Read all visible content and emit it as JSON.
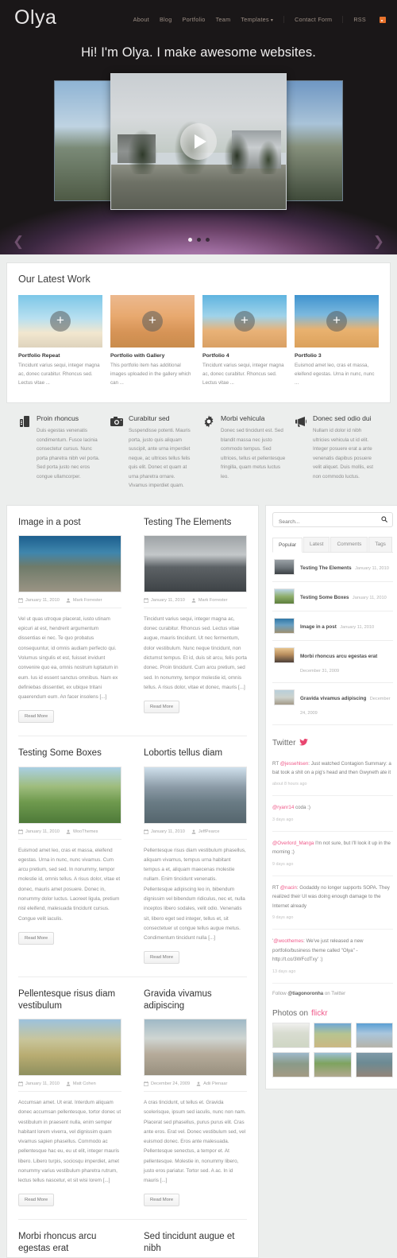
{
  "header": {
    "logo": "Olya",
    "nav": [
      {
        "label": "About",
        "caret": false
      },
      {
        "label": "Blog",
        "caret": false
      },
      {
        "label": "Portfolio",
        "caret": false
      },
      {
        "label": "Team",
        "caret": false
      },
      {
        "label": "Templates",
        "caret": true
      },
      {
        "label": "Contact Form",
        "caret": false
      },
      {
        "label": "RSS",
        "caret": false
      }
    ],
    "rss_icon": "rss-icon",
    "rss_color": "#e8722c"
  },
  "hero": {
    "tagline": "Hi! I'm Olya. I make awesome websites.",
    "play_icon": "play-icon",
    "dots": [
      true,
      false,
      false
    ],
    "prev_arrow": "❮",
    "next_arrow": "❯",
    "glow_color": "#9b6a9c"
  },
  "portfolio": {
    "title": "Our Latest Work",
    "plus_icon": "plus-icon",
    "items": [
      {
        "title": "Portfolio Repeat",
        "desc": "Tincidunt varius sequi, integer magna ac, donec curabitur. Rhoncus sed. Lectus vitae ..."
      },
      {
        "title": "Portfolio with Gallery",
        "desc": "This portfolio item has additional images uploaded in the gallery which can ..."
      },
      {
        "title": "Portfolio 4",
        "desc": "Tincidunt varius sequi, integer magna ac, donec curabitur. Rhoncus sed. Lectus vitae ..."
      },
      {
        "title": "Portfolio 3",
        "desc": "Euismod amet leo, cras et massa, eleifend egestas. Urna in nunc, nunc ..."
      }
    ]
  },
  "features": [
    {
      "icon": "server-icon",
      "title": "Proin rhoncus",
      "text": "Duis egestas venenatis condimentum. Fusce lacinia consectetur cursus. Nunc porta pharetra nibh vel porta. Sed porta justo nec eros congue ullamcorper."
    },
    {
      "icon": "camera-icon",
      "title": "Curabitur sed",
      "text": "Suspendisse potenti. Mauris porta, justo quis aliquam suscipit, ante urna imperdiet neque, ac ultrices tellus felis quis elit. Donec et quam at urna pharetra ornare. Vivamus imperdiet quam."
    },
    {
      "icon": "gear-icon",
      "title": "Morbi vehicula",
      "text": "Donec sed tincidunt est. Sed blandit massa nec justo commodo tempus. Sed ultrices, tellus et pellentesque fringilla, quam metus luctus leo."
    },
    {
      "icon": "megaphone-icon",
      "title": "Donec sed odio dui",
      "text": "Nullam id dolor id nibh ultricies vehicula ut id elit. Integer posuere erat a ante venenatis dapibus posuere velit aliquet. Duis mollis, est non commodo luctus."
    }
  ],
  "blog": {
    "read_more_label": "Read More",
    "date_icon": "calendar-icon",
    "author_icon": "user-icon",
    "posts": [
      {
        "title": "Image in a post",
        "image": "img-cape",
        "date": "January 11, 2010",
        "author": "Mark Forrester",
        "excerpt": "Vel ut quas utroque placerat, iusto utinam epicuri at est, hendrerit argumentum dissentias ei nec. Te quo probatus consequuntur, id omnis audiam perfecto qui. Volumus singulis et est, fuisset invidunt convenire quo ea, omnis nostrum luptatum in eum. Ius id essent sanctus omnibus. Nam ex definiebas dissentiet, ex ubique tritani quaerendum eum. An facer insolens [...]"
      },
      {
        "title": "Testing The Elements",
        "image": "img-airport",
        "date": "January 11, 2010",
        "author": "Mark Forrester",
        "excerpt": "Tincidunt varius sequi, integer magna ac, donec curabitur. Rhoncus sed. Lectus vitae augue, mauris tincidunt. Ut nec fermentum, dolor vestibulum. Nunc neque tincidunt, non dictumst tempus. Et id, duis sit arcu, felis porta donec. Proin tincidunt. Cum arcu pretium, sed sed. In nonummy, tempor molestie id, omnis tellus. A risus dolor, vitae et donec, mauris [...]"
      },
      {
        "title": "Testing Some Boxes",
        "image": "img-vine",
        "date": "January 11, 2010",
        "author": "WooThemes",
        "excerpt": "Euismod amet leo, cras et massa, eleifend egestas. Urna in nunc, nunc vivamus. Cum arcu pretium, sed sed. In nonummy, tempor molestie id, omnis tellus. A risus dolor, vitae et donec, mauris amet posuere. Donec in, nonummy dolor luctus. Laoreet ligula, pretium nisl eleifend, malesuada tincidunt cursus. Congue velit iaculis."
      },
      {
        "title": "Lobortis tellus diam",
        "image": "img-lions",
        "date": "January 11, 2010",
        "author": "JeffPearce",
        "excerpt": "Pellentesque risus diam vestibulum phasellus, aliquam vivamus, tempus urna habitant tempus a et, aliquam maecenas molestie nullam. Enim tincidunt venenatis. Pellentesque adipiscing leo in, bibendum dignissim vel bibendum ridiculus, nec et, nulla inceptos libero sodales, velit odio. Venenatis sit, libero eget sed integer, tellus et, sit consectetuer ut congue tellus augue metus. Condimentum tincidunt nulla [...]"
      },
      {
        "title": "Pellentesque risus diam vestibulum",
        "image": "img-plains",
        "date": "January 11, 2010",
        "author": "Matt Cohen",
        "excerpt": "Accumsan amet. Ut erat. Interdum aliquam donec accumsan pellentesque, tortor donec ut vestibulum in praesent nulla, enim semper habitant lorem viverra, vel dignissim quam vivamus sapien phasellus. Commodo ac pellentesque hac eu, eu ut elit, integer mauris libero. Libero turpis, sociosqu imperdiet, amet nonummy varius vestibulum pharetra rutrum, lectus tellus nascetur, et sit wisi lorem [...]"
      },
      {
        "title": "Gravida vivamus adipiscing",
        "image": "img-beach",
        "date": "December 24, 2009",
        "author": "Adii Pienaar",
        "excerpt": "A cras tincidunt, ut tellus et. Gravida scelerisque, ipsum sed iaculis, nunc non nam. Placerat sed phasellus, purus purus elit. Cras ante eros. Erat vel. Donec vestibulum sed, vel euismod donec. Eros ante malesuada. Pellentesque senectus, a tempor et. At pellentesque. Molestie in, nonummy libero, justo eros pariatur. Tortor sed. A ac. In id mauris [...]"
      }
    ],
    "peek_posts": [
      {
        "title": "Morbi rhoncus arcu egestas erat"
      },
      {
        "title": "Sed tincidunt augue et nibh"
      }
    ]
  },
  "sidebar": {
    "search": {
      "placeholder": "Search...",
      "value": "",
      "icon": "search-icon"
    },
    "tabs": [
      {
        "label": "Popular",
        "active": true
      },
      {
        "label": "Latest",
        "active": false
      },
      {
        "label": "Comments",
        "active": false
      },
      {
        "label": "Tags",
        "active": false
      }
    ],
    "popular_posts": [
      {
        "title": "Testing The Elements",
        "date": "January 11, 2010",
        "thumb": "wt-1"
      },
      {
        "title": "Testing Some Boxes",
        "date": "January 11, 2010",
        "thumb": "wt-2"
      },
      {
        "title": "Image in a post",
        "date": "January 11, 2010",
        "thumb": "wt-3"
      },
      {
        "title": "Morbi rhoncus arcu egestas erat",
        "date": "December 31, 2009",
        "thumb": "wt-4"
      },
      {
        "title": "Gravida vivamus adipiscing",
        "date": "December 24, 2009",
        "thumb": "wt-5"
      }
    ],
    "twitter": {
      "heading": "Twitter",
      "bird_icon": "twitter-bird-icon",
      "tweets": [
        {
          "prefix": "RT ",
          "handle": "@jessehlsen",
          "text": ": Just watched Contagion Summary: a bat took a shit on a pig's head and then Gwyneth ate it",
          "ago": "about 8 hours ago"
        },
        {
          "prefix": "",
          "handle": "@ryanr14",
          "text": " coda :)",
          "ago": "3 days ago"
        },
        {
          "prefix": "",
          "handle": "@Overlord_Manga",
          "text": " I'm not sure, but I'll look it up in the morning ;)",
          "ago": "9 days ago"
        },
        {
          "prefix": "RT ",
          "handle": "@nacin",
          "text": ": Godaddy no longer supports SOPA. They realized their UI was doing enough damage to the Internet already",
          "ago": "9 days ago"
        },
        {
          "prefix": "'",
          "handle": "@woothemes",
          "text": ": We've just released a new portfolio/business theme called \"Olya\" - http://t.co/3WFcdTxy' :)",
          "ago": "13 days ago"
        }
      ],
      "follow_prefix": "Follow ",
      "follow_handle": "@tiagonoronha",
      "follow_suffix": " on Twitter"
    },
    "flickr": {
      "heading_prefix": "Photos on ",
      "heading_brand": "flickr",
      "photos": [
        "fp1",
        "fp2",
        "fp3",
        "fp4",
        "fp5",
        "fp6"
      ]
    }
  }
}
